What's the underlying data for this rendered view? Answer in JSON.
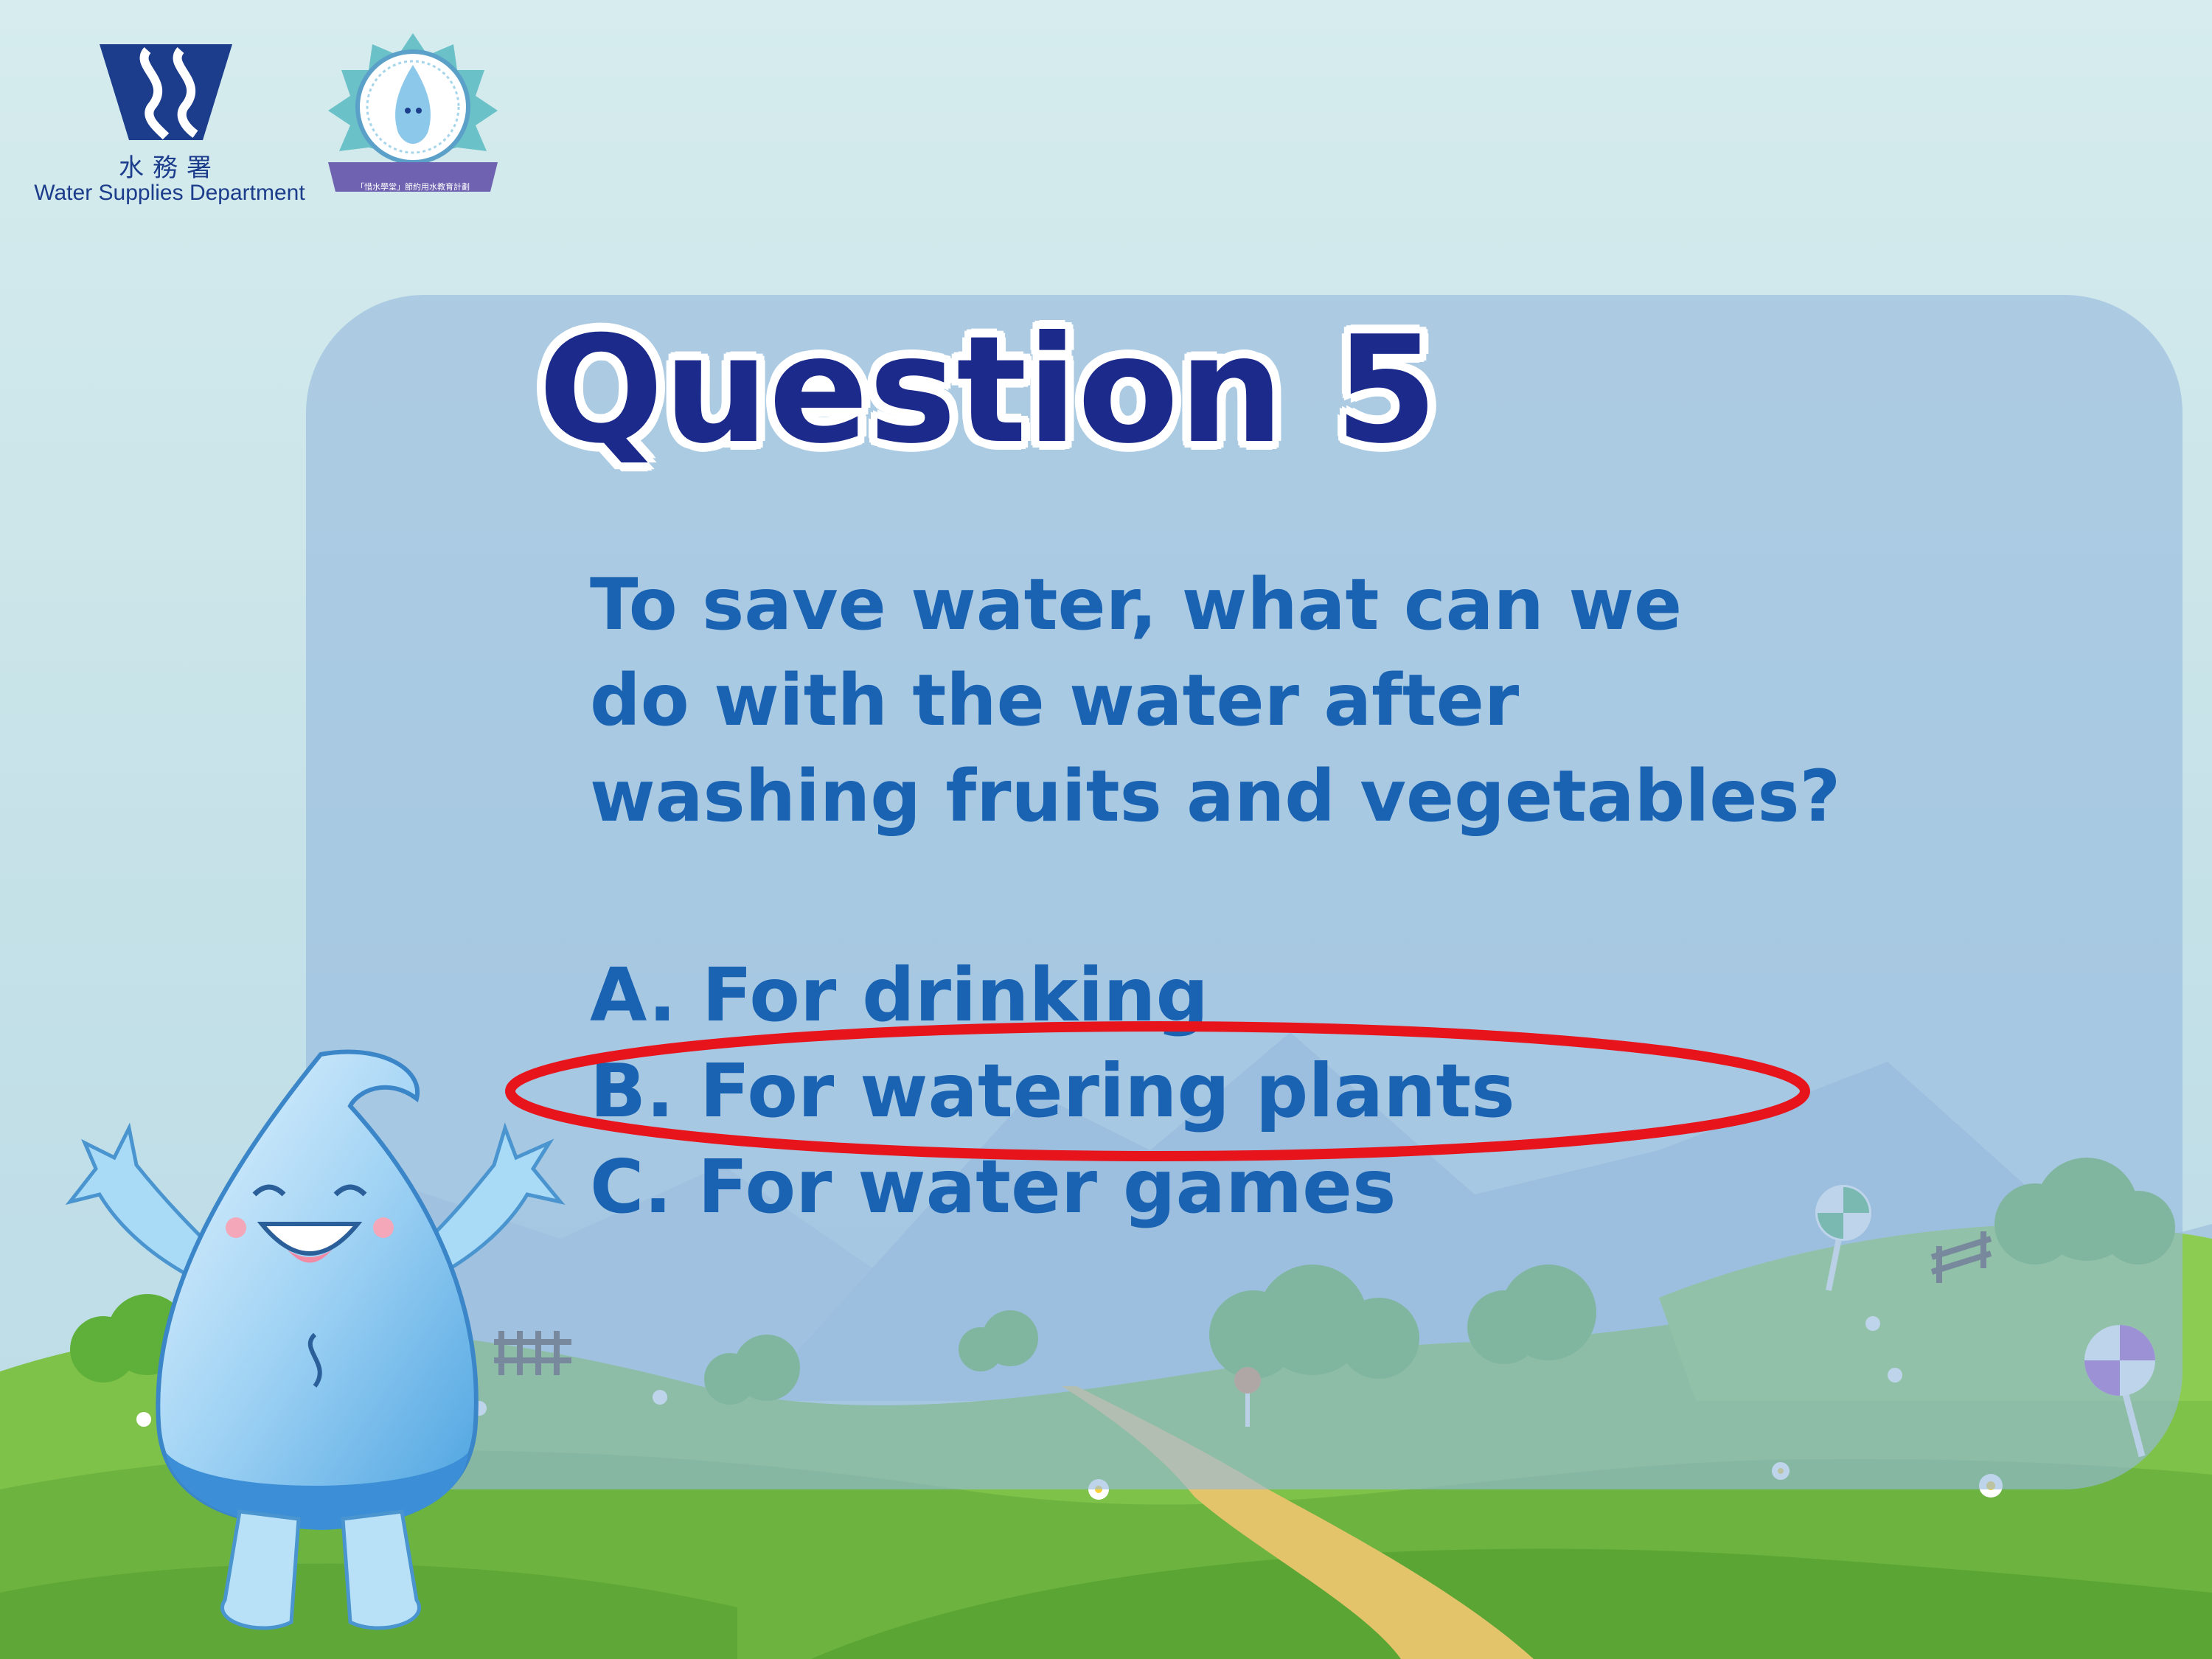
{
  "header": {
    "org_name_cn": "水務署",
    "org_name_en": "Water Supplies Department",
    "badge_text": "「惜水學堂」節約用水教育計劃"
  },
  "slide": {
    "title": "Question 5",
    "question_lines": [
      "To save water, what can we",
      "do with the water after",
      "washing fruits and vegetables?"
    ],
    "options": [
      {
        "label": "A. For drinking",
        "selected": false
      },
      {
        "label": "B. For watering plants",
        "selected": true
      },
      {
        "label": "C. For water games",
        "selected": false
      }
    ]
  },
  "colors": {
    "title_text": "#1c2a8c",
    "body_text": "#1a63b2",
    "answer_highlight": "#e8141c",
    "panel": "#96bade"
  },
  "icons": [
    "wsd-logo-icon",
    "water-drop-badge-icon",
    "water-drop-mascot-icon",
    "lollipop-icon",
    "flower-icon",
    "fence-icon"
  ]
}
